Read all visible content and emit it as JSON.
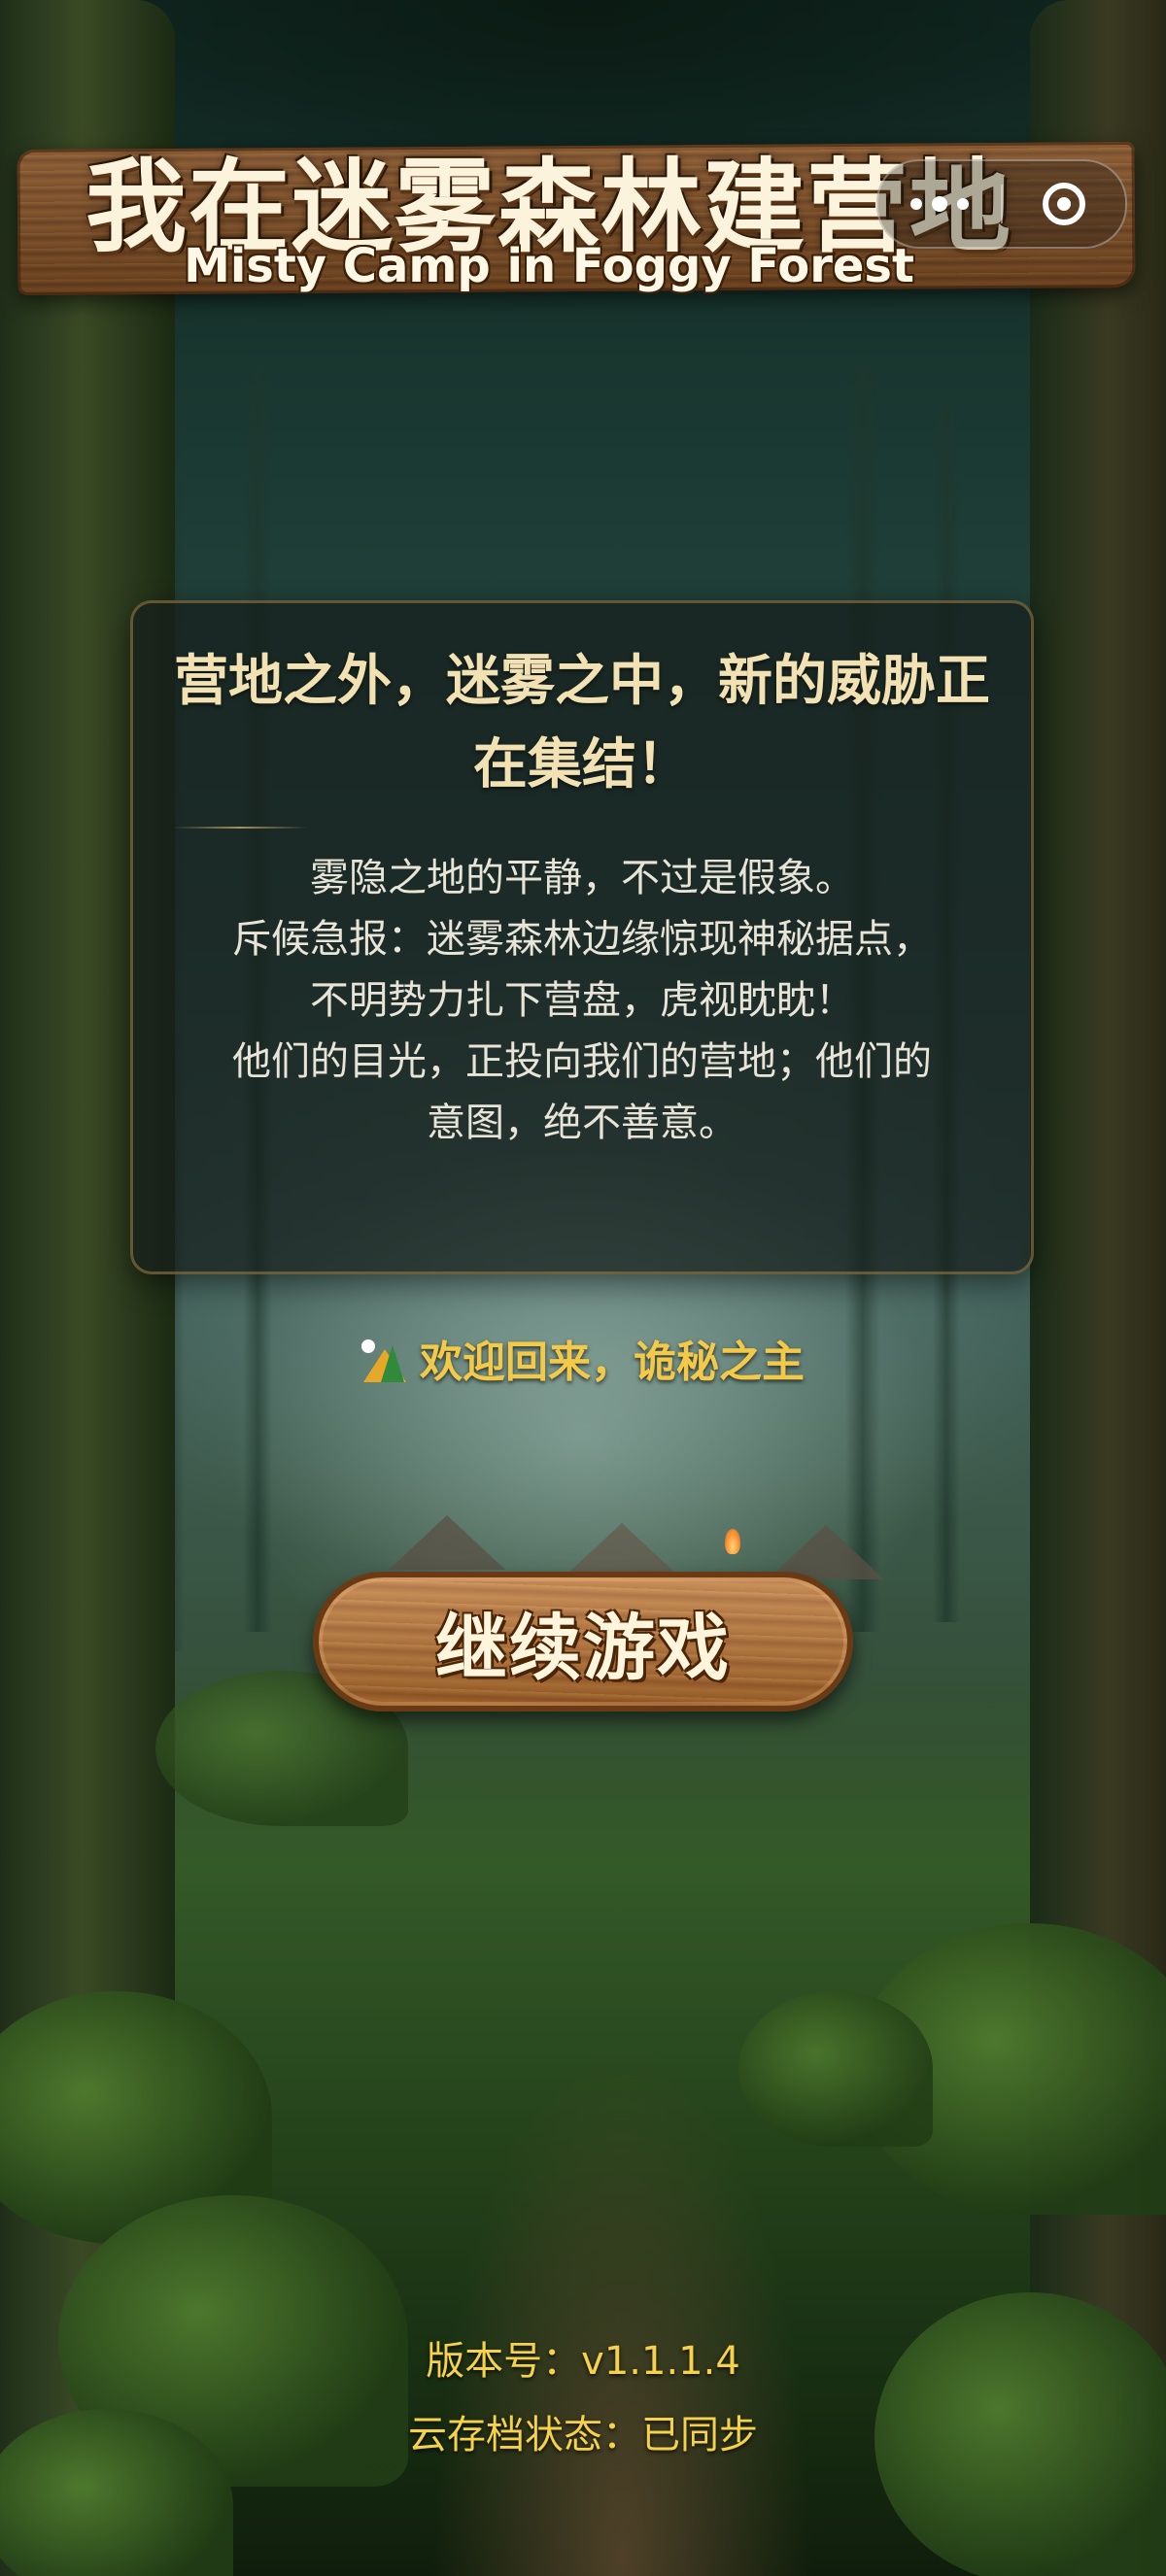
{
  "header": {
    "title_cn": "我在迷雾森林建营地",
    "title_en": "Misty Camp in Foggy Forest"
  },
  "capsule": {
    "more_icon": "more-dots-icon",
    "close_icon": "target-close-icon"
  },
  "story": {
    "title": "营地之外，迷雾之中，新的威胁正在集结！",
    "lines": [
      "雾隐之地的平静，不过是假象。",
      "斥候急报：迷雾森林边缘惊现神秘据点，",
      "不明势力扎下营盘，虎视眈眈！",
      "他们的目光，正投向我们的营地；他们的",
      "意图，绝不善意。"
    ]
  },
  "welcome": {
    "icon": "camping-icon",
    "text": "欢迎回来，诡秘之主"
  },
  "actions": {
    "continue_label": "继续游戏"
  },
  "footer": {
    "version": "版本号：v1.1.1.4",
    "cloud_save": "云存档状态：已同步"
  },
  "colors": {
    "accent_gold": "#f3c94a",
    "card_title": "#f2e2b3",
    "wood": "#a55f28"
  }
}
